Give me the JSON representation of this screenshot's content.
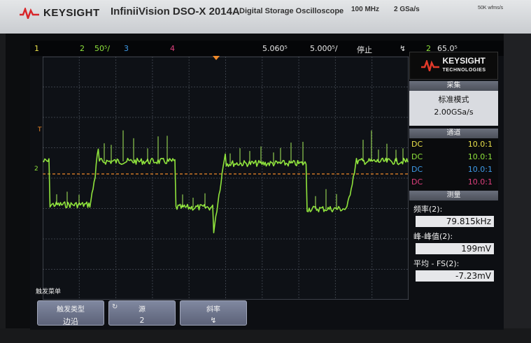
{
  "bezel": {
    "brand": "KEYSIGHT",
    "model": "InfiniiVision DSO-X 2014A",
    "subtitle": "Digital Storage Oscilloscope",
    "bandwidth": "100 MHz",
    "sample_rate": "2 GSa/s",
    "waveform_rate": "50K wfms/s"
  },
  "status_bar": {
    "ch1": "1",
    "ch2": "2",
    "ch2_scale": "50⁵/",
    "ch3": "3",
    "ch4": "4",
    "delay": "5.060⁵",
    "timebase": "5.000⁵/",
    "run_state": "停止",
    "trigger_symbol": "↯",
    "trigger_source": "2",
    "trigger_level": "65.0⁵"
  },
  "panel": {
    "logo_line1": "KEYSIGHT",
    "logo_line2": "TECHNOLOGIES",
    "acquire_title": "采集",
    "acquire_mode": "标准模式",
    "acquire_rate": "2.00GSa/s",
    "channels_title": "通道",
    "channels": [
      {
        "coupling": "DC",
        "probe": "10.0:1",
        "color": "#e9e04a"
      },
      {
        "coupling": "DC",
        "probe": "10.0:1",
        "color": "#8fe33c"
      },
      {
        "coupling": "DC",
        "probe": "10.0:1",
        "color": "#3f9be8"
      },
      {
        "coupling": "DC",
        "probe": "10.0:1",
        "color": "#e0407e"
      }
    ],
    "measure_title": "测量",
    "measurements": [
      {
        "label": "频率(2):",
        "value": "79.815kHz"
      },
      {
        "label": "峰-峰值(2):",
        "value": "199mV"
      },
      {
        "label": "平均 - FS(2):",
        "value": "-7.23mV"
      }
    ]
  },
  "menu_title": "触发菜单",
  "softkeys": [
    {
      "label": "触发类型",
      "value": "边沿"
    },
    {
      "label": "源",
      "value": "2"
    },
    {
      "label": "斜率",
      "value": "↯"
    }
  ],
  "markers": {
    "trigger_marker": "T",
    "ch2_marker": "2"
  },
  "colors": {
    "ch1": "#e9e04a",
    "ch2": "#8fe33c",
    "ch3": "#3f9be8",
    "ch4": "#e0407e",
    "trigger_line": "#f08a2a"
  }
}
